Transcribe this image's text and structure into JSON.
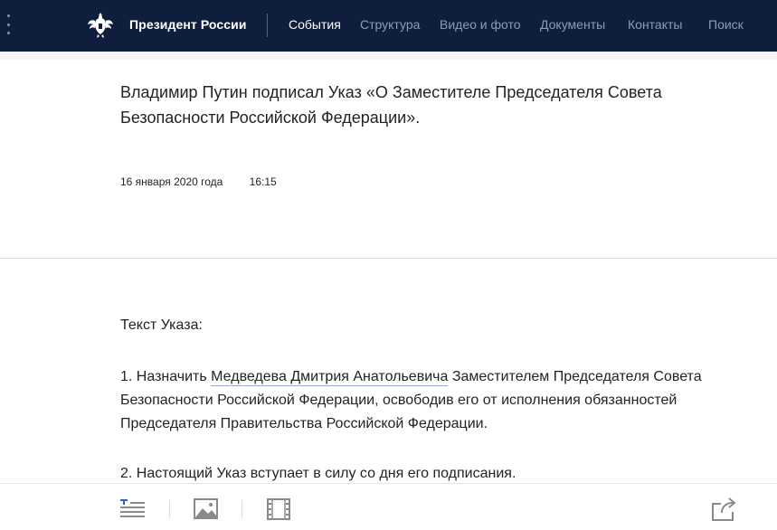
{
  "header": {
    "site_title": "Президент России",
    "nav": [
      {
        "label": "События",
        "active": true
      },
      {
        "label": "Структура",
        "active": false
      },
      {
        "label": "Видео и фото",
        "active": false
      },
      {
        "label": "Документы",
        "active": false
      },
      {
        "label": "Контакты",
        "active": false
      },
      {
        "label": "Поиск",
        "active": false
      }
    ]
  },
  "article": {
    "headline": "Владимир Путин подписал Указ «О Заместителе Председателя Совета Безопасности Российской Федерации».",
    "date": "16 января 2020 года",
    "time": "16:15",
    "section_label": "Текст Указа:",
    "para1_prefix": "1. Назначить ",
    "para1_link": "Медведева Дмитрия Анатольевича",
    "para1_suffix": " Заместителем Председателя Совета Безопасности Российской Федерации, освободив его от исполнения обязанностей Председателя Правительства Российской Федерации.",
    "para2": "2. Настоящий Указ вступает в силу со дня его подписания."
  },
  "toolbar": {
    "icons": [
      "text-view-icon",
      "photo-view-icon",
      "video-view-icon",
      "share-icon"
    ]
  },
  "colors": {
    "nav_bg": "#0f1e3d",
    "nav_active": "#ffffff",
    "nav_inactive": "#8f9bb5",
    "accent_blue": "#2e62c4"
  }
}
